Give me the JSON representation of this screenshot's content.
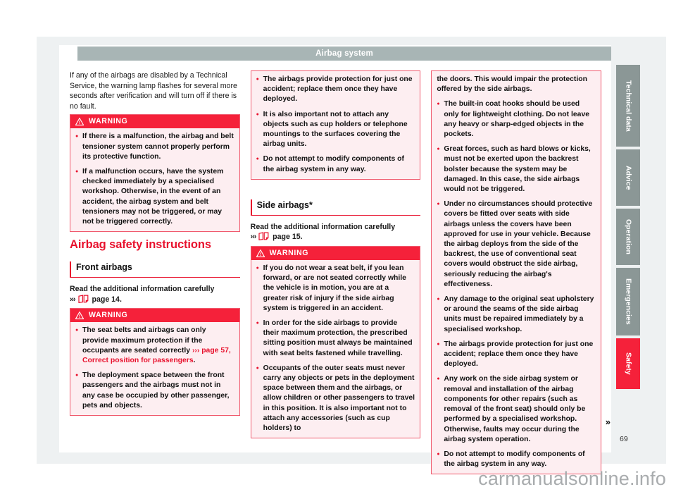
{
  "header": {
    "title": "Airbag system"
  },
  "folio": {
    "page_number": "69"
  },
  "watermark": {
    "text": "carmanualsonline.info"
  },
  "continuation_marker": "»",
  "icons": {
    "warning": "warning-triangle-icon",
    "reference": "manual-page-icon",
    "chevrons": "›››"
  },
  "colors": {
    "accent_red": "#e8112d",
    "warning_header": "#f5213a",
    "warning_bg": "#fdeef1",
    "warning_border": "#f05a6e",
    "header_bar": "#a8b5b5",
    "tab_inactive": "#8b9796",
    "page_bg": "#eef1f2"
  },
  "tabs": [
    {
      "label": "Technical data",
      "active": false
    },
    {
      "label": "Advice",
      "active": false
    },
    {
      "label": "Operation",
      "active": false
    },
    {
      "label": "Emergencies",
      "active": false
    },
    {
      "label": "Safety",
      "active": true
    }
  ],
  "column_left": {
    "intro_paragraph": "If any of the airbags are disabled by a Technical Service, the warning lamp flashes for several more seconds after verification and will turn off if there is no fault.",
    "warning_1": {
      "label": "WARNING",
      "items": [
        "If there is a malfunction, the airbag and belt tensioner system cannot properly perform its protective function.",
        "If a malfunction occurs, have the system checked immediately by a specialised workshop. Otherwise, in the event of an accident, the airbag system and belt tensioners may not be triggered, or may not be triggered correctly."
      ]
    },
    "section_title": "Airbag safety instructions",
    "subsection_title": "Front airbags",
    "read_more_prefix": "Read the additional information carefully",
    "read_more_page": "page 14.",
    "warning_2": {
      "label": "WARNING",
      "items": [
        {
          "text_before": "The seat belts and airbags can only provide maximum protection if the occupants are seated correctly ",
          "xref": "››› page 57, Correct position for passengers",
          "text_after": "."
        },
        {
          "text_before": "The deployment space between the front passengers and the airbags must not in any case be occupied by other passenger, pets and objects.",
          "xref": "",
          "text_after": ""
        }
      ]
    }
  },
  "column_middle": {
    "warning_1_continued": {
      "items": [
        "The airbags provide protection for just one accident; replace them once they have deployed.",
        "It is also important not to attach any objects such as cup holders or telephone mountings to the surfaces covering the airbag units.",
        "Do not attempt to modify components of the airbag system in any way."
      ]
    },
    "subsection_title": "Side airbags*",
    "read_more_prefix": "Read the additional information carefully",
    "read_more_page": "page 15.",
    "warning_3": {
      "label": "WARNING",
      "items": [
        "If you do not wear a seat belt, if you lean forward, or are not seated correctly while the vehicle is in motion, you are at a greater risk of injury if the side airbag system is triggered in an accident.",
        "In order for the side airbags to provide their maximum protection, the prescribed sitting position must always be maintained with seat belts fastened while travelling.",
        "Occupants of the outer seats must never carry any objects or pets in the deployment space between them and the airbags, or allow children or other passengers to travel in this position. It is also important not to attach any accessories (such as cup holders) to"
      ]
    }
  },
  "column_right": {
    "warning_3_continued": {
      "continuation_text": "the doors. This would impair the protection offered by the side airbags.",
      "items": [
        "The built-in coat hooks should be used only for lightweight clothing. Do not leave any heavy or sharp-edged objects in the pockets.",
        "Great forces, such as hard blows or kicks, must not be exerted upon the backrest bolster because the system may be damaged. In this case, the side airbags would not be triggered.",
        "Under no circumstances should protective covers be fitted over seats with side airbags unless the covers have been approved for use in your vehicle. Because the airbag deploys from the side of the backrest, the use of conventional seat covers would obstruct the side airbag, seriously reducing the airbag's effectiveness.",
        "Any damage to the original seat upholstery or around the seams of the side airbag units must be repaired immediately by a specialised workshop.",
        "The airbags provide protection for just one accident; replace them once they have deployed.",
        "Any work on the side airbag system or removal and installation of the airbag components for other repairs (such as removal of the front seat) should only be performed by a specialised workshop. Otherwise, faults may occur during the airbag system operation.",
        "Do not attempt to modify components of the airbag system in any way."
      ]
    }
  }
}
